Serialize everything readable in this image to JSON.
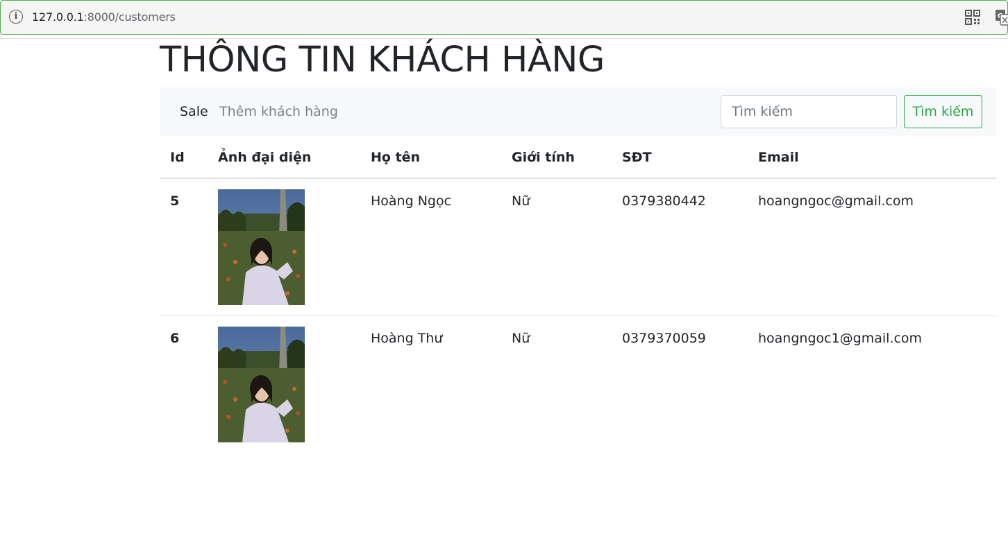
{
  "browser": {
    "url_host": "127.0.0.1",
    "url_path": ":8000/customers"
  },
  "page": {
    "title": "THÔNG TIN KHÁCH HÀNG"
  },
  "navbar": {
    "brand": "Sale",
    "add_link": "Thêm khách hàng",
    "search_placeholder": "Tìm kiếm",
    "search_button": "Tìm kiếm"
  },
  "table": {
    "headers": [
      "Id",
      "Ảnh đại diện",
      "Họ tên",
      "Giới tính",
      "SĐT",
      "Email"
    ],
    "rows": [
      {
        "id": "5",
        "name": "Hoàng Ngọc",
        "gender": "Nữ",
        "phone": "0379380442",
        "email": "hoangngoc@gmail.com"
      },
      {
        "id": "6",
        "name": "Hoàng Thư",
        "gender": "Nữ",
        "phone": "0379370059",
        "email": "hoangngoc1@gmail.com"
      }
    ]
  },
  "colors": {
    "accent_green": "#28a745",
    "navbar_bg": "#f8f9fa",
    "text": "#212529"
  },
  "icons": [
    "info-icon",
    "qr-code-icon",
    "translate-icon"
  ]
}
